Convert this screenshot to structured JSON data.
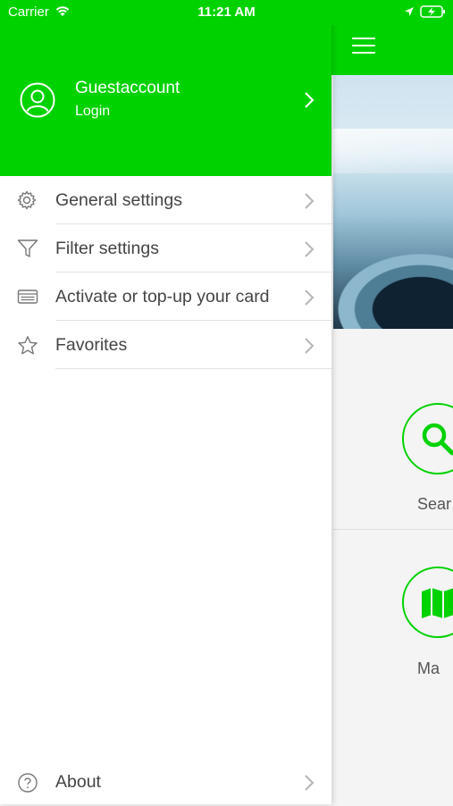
{
  "status_bar": {
    "carrier": "Carrier",
    "time": "11:21 AM"
  },
  "drawer": {
    "profile": {
      "name": "Guestaccount",
      "action": "Login"
    },
    "menu_items": [
      {
        "label": "General settings",
        "icon": "gear-icon"
      },
      {
        "label": "Filter settings",
        "icon": "filter-icon"
      },
      {
        "label": "Activate or top-up your card",
        "icon": "card-icon"
      },
      {
        "label": "Favorites",
        "icon": "star-icon"
      }
    ],
    "about": {
      "label": "About",
      "icon": "help-icon"
    }
  },
  "background_app": {
    "buttons": [
      {
        "label": "Sear",
        "icon": "search-icon"
      },
      {
        "label": "Ma",
        "icon": "map-icon"
      }
    ]
  },
  "colors": {
    "brand_green": "#00d200",
    "text_gray": "#444444",
    "chevron_gray": "#b5b5b5"
  }
}
